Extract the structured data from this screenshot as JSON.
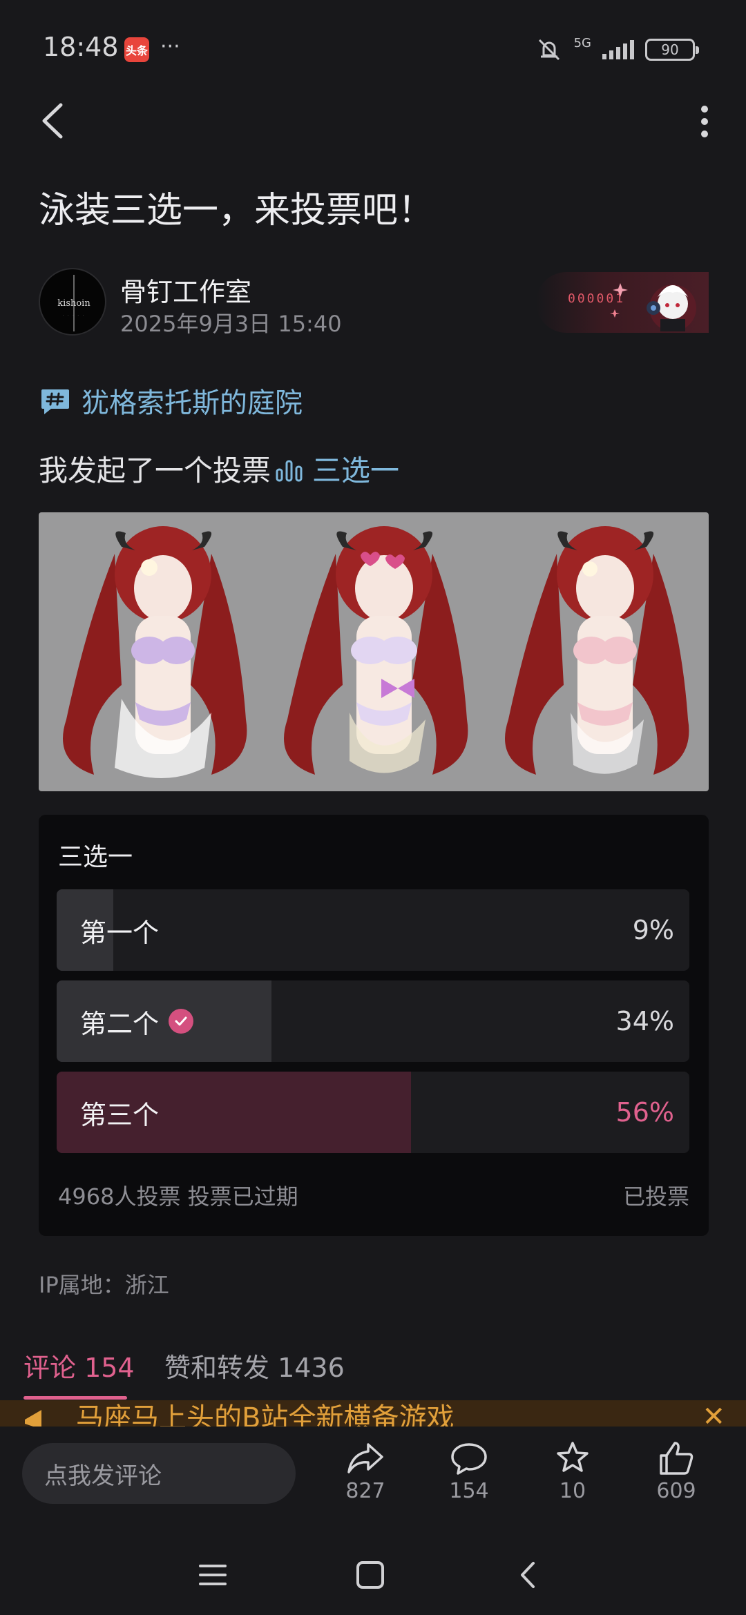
{
  "status_bar": {
    "time": "18:48",
    "app_badge": "头条",
    "dots": "···",
    "network": "5G",
    "battery": "90"
  },
  "post": {
    "title": "泳装三选一，来投票吧！",
    "author": "骨钉工作室",
    "avatar_text": "kishoin",
    "timestamp": "2025年9月3日 15:40",
    "decoration_code": "000001",
    "topic": "犹格索托斯的庭院",
    "body_text": "我发起了一个投票",
    "poll_link": "三选一"
  },
  "poll": {
    "title": "三选一",
    "options": [
      {
        "label": "第一个",
        "percent": "9%",
        "share": 0.09,
        "selected": false,
        "winner": false
      },
      {
        "label": "第二个",
        "percent": "34%",
        "share": 0.34,
        "selected": true,
        "winner": false
      },
      {
        "label": "第三个",
        "percent": "56%",
        "share": 0.56,
        "selected": false,
        "winner": true
      }
    ],
    "footer": "4968人投票 投票已过期",
    "status": "已投票"
  },
  "ip_location": "IP属地：浙江",
  "tabs": {
    "comments": "评论 154",
    "likes_reposts": "赞和转发 1436"
  },
  "promo": {
    "text": "马座马上头的B站全新横备游戏"
  },
  "bottom_bar": {
    "comment_placeholder": "点我发评论",
    "share_count": "827",
    "comment_count": "154",
    "favorite_count": "10",
    "like_count": "609"
  },
  "colors": {
    "accent_pink": "#e0618e",
    "topic_blue": "#7fb8dc",
    "background": "#18181b",
    "promo_orange": "#e2a03a"
  },
  "icons": [
    "back-arrow-icon",
    "more-vertical-icon",
    "hashtag-icon",
    "bar-chart-icon",
    "check-icon",
    "megaphone-icon",
    "close-icon",
    "share-icon",
    "comment-icon",
    "star-icon",
    "thumbs-up-icon",
    "menu-icon",
    "home-square-icon",
    "system-back-icon"
  ]
}
